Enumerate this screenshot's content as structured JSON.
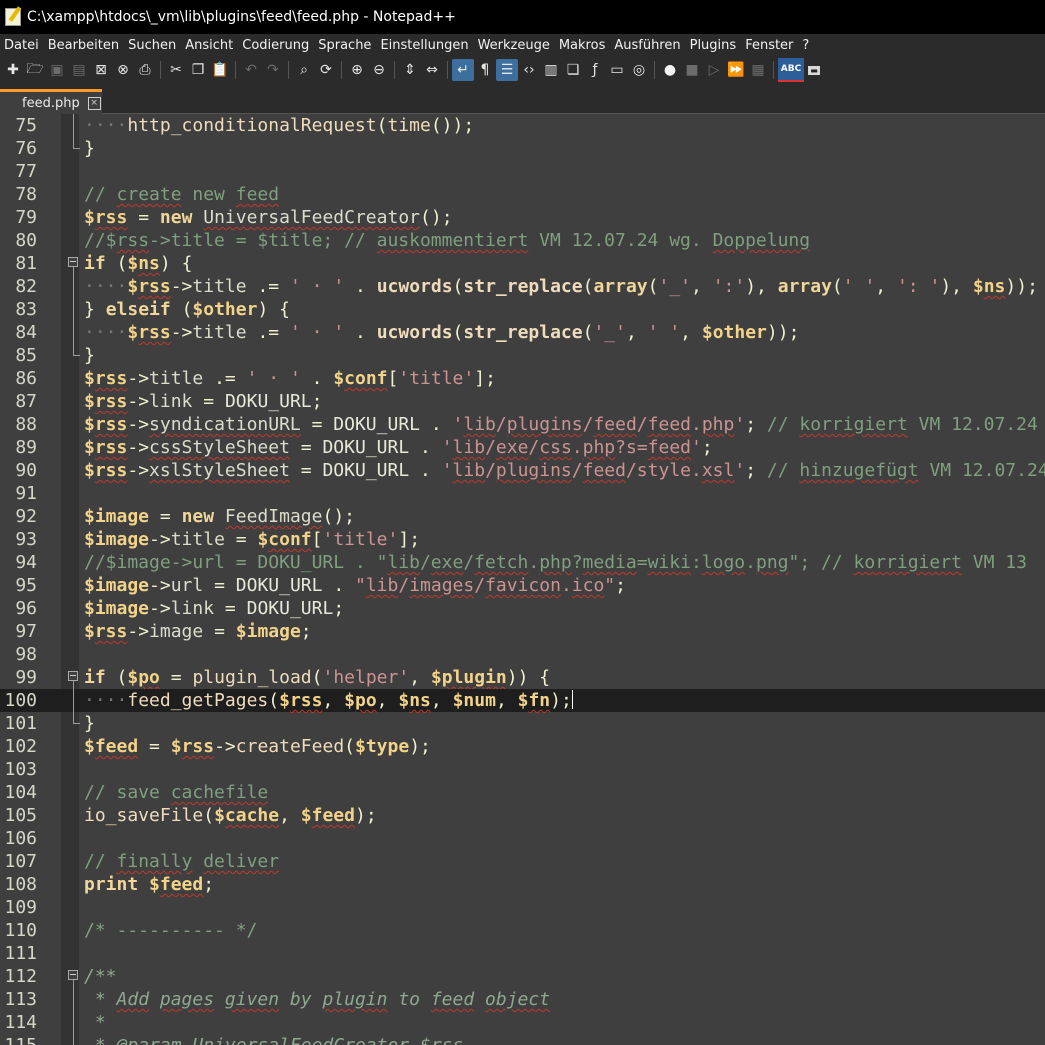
{
  "window": {
    "title": "C:\\xampp\\htdocs\\_vm\\lib\\plugins\\feed\\feed.php - Notepad++"
  },
  "menu": [
    "Datei",
    "Bearbeiten",
    "Suchen",
    "Ansicht",
    "Codierung",
    "Sprache",
    "Einstellungen",
    "Werkzeuge",
    "Makros",
    "Ausführen",
    "Plugins",
    "Fenster",
    "?"
  ],
  "toolbar": {
    "icons": [
      "new-file-icon",
      "open-file-icon",
      "save-icon",
      "save-all-icon",
      "close-icon",
      "close-all-icon",
      "print-icon",
      "cut-icon",
      "copy-icon",
      "paste-icon",
      "undo-icon",
      "redo-icon",
      "find-icon",
      "replace-icon",
      "zoom-in-icon",
      "zoom-out-icon",
      "sync-vertical-icon",
      "sync-horizontal-icon",
      "word-wrap-icon",
      "show-all-characters-icon",
      "indent-guide-icon",
      "xml-tag-icon",
      "document-map-icon",
      "document-list-icon",
      "function-list-icon",
      "folder-as-workspace-icon",
      "monitoring-icon",
      "record-macro-icon",
      "stop-record-icon",
      "play-macro-icon",
      "run-macro-multiple-icon",
      "save-macro-icon",
      "spell-check-icon",
      "spell-check-auto-icon"
    ],
    "spellcheck_label": "ABC"
  },
  "tab": {
    "label": "feed.php",
    "close": "×"
  },
  "editor": {
    "lines": [
      {
        "n": "75",
        "fold": "bar",
        "code": "····http_conditionalRequest(time());"
      },
      {
        "n": "76",
        "fold": "end",
        "code": "}"
      },
      {
        "n": "77",
        "fold": "",
        "code": ""
      },
      {
        "n": "78",
        "fold": "",
        "code": "// create new feed"
      },
      {
        "n": "79",
        "fold": "",
        "code": "$rss = new UniversalFeedCreator();"
      },
      {
        "n": "80",
        "fold": "",
        "code": "//$rss->title = $title; // auskommentiert VM 12.07.24 wg. Doppelung"
      },
      {
        "n": "81",
        "fold": "box",
        "code": "if ($ns) {"
      },
      {
        "n": "82",
        "fold": "bar",
        "code": "····$rss->title .= ' · ' . ucwords(str_replace(array('_', ':'), array(' ', ': '), $ns));"
      },
      {
        "n": "83",
        "fold": "bar",
        "code": "} elseif ($other) {"
      },
      {
        "n": "84",
        "fold": "bar",
        "code": "····$rss->title .= ' · ' . ucwords(str_replace('_', ' ', $other));"
      },
      {
        "n": "85",
        "fold": "end",
        "code": "}"
      },
      {
        "n": "86",
        "fold": "",
        "code": "$rss->title .= ' · ' . $conf['title'];"
      },
      {
        "n": "87",
        "fold": "",
        "code": "$rss->link = DOKU_URL;"
      },
      {
        "n": "88",
        "fold": "",
        "code": "$rss->syndicationURL = DOKU_URL . 'lib/plugins/feed/feed.php'; // korrigiert VM 12.07.24"
      },
      {
        "n": "89",
        "fold": "",
        "code": "$rss->cssStyleSheet = DOKU_URL . 'lib/exe/css.php?s=feed';"
      },
      {
        "n": "90",
        "fold": "",
        "code": "$rss->xslStyleSheet = DOKU_URL . 'lib/plugins/feed/style.xsl'; // hinzugefügt VM 12.07.24"
      },
      {
        "n": "91",
        "fold": "",
        "code": ""
      },
      {
        "n": "92",
        "fold": "",
        "code": "$image = new FeedImage();"
      },
      {
        "n": "93",
        "fold": "",
        "code": "$image->title = $conf['title'];"
      },
      {
        "n": "94",
        "fold": "",
        "code": "//$image->url = DOKU_URL . \"lib/exe/fetch.php?media=wiki:logo.png\"; // korrigiert VM 13"
      },
      {
        "n": "95",
        "fold": "",
        "code": "$image->url = DOKU_URL . \"lib/images/favicon.ico\";"
      },
      {
        "n": "96",
        "fold": "",
        "code": "$image->link = DOKU_URL;"
      },
      {
        "n": "97",
        "fold": "",
        "code": "$rss->image = $image;"
      },
      {
        "n": "98",
        "fold": "",
        "code": ""
      },
      {
        "n": "99",
        "fold": "box",
        "code": "if ($po = plugin_load('helper', $plugin)) {"
      },
      {
        "n": "100",
        "fold": "bar",
        "code": "····feed_getPages($rss, $po, $ns, $num, $fn);",
        "current": true
      },
      {
        "n": "101",
        "fold": "end",
        "code": "}"
      },
      {
        "n": "102",
        "fold": "",
        "code": "$feed = $rss->createFeed($type);"
      },
      {
        "n": "103",
        "fold": "",
        "code": ""
      },
      {
        "n": "104",
        "fold": "",
        "code": "// save cachefile"
      },
      {
        "n": "105",
        "fold": "",
        "code": "io_saveFile($cache, $feed);"
      },
      {
        "n": "106",
        "fold": "",
        "code": ""
      },
      {
        "n": "107",
        "fold": "",
        "code": "// finally deliver"
      },
      {
        "n": "108",
        "fold": "",
        "code": "print $feed;"
      },
      {
        "n": "109",
        "fold": "",
        "code": ""
      },
      {
        "n": "110",
        "fold": "",
        "code": "/* ---------- */"
      },
      {
        "n": "111",
        "fold": "",
        "code": ""
      },
      {
        "n": "112",
        "fold": "box",
        "code": "/**"
      },
      {
        "n": "113",
        "fold": "bar",
        "code": " * Add pages given by plugin to feed object"
      },
      {
        "n": "114",
        "fold": "bar",
        "code": " *"
      },
      {
        "n": "115",
        "fold": "bar",
        "code": " * @param UniversalFeedCreator $rss"
      }
    ]
  }
}
